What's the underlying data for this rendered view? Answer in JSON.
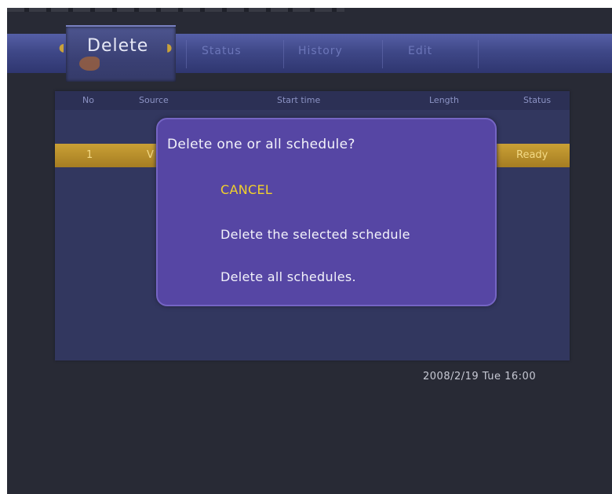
{
  "tabs": {
    "active": "Delete",
    "items": [
      "Status",
      "History",
      "Edit"
    ]
  },
  "table": {
    "headers": [
      "No",
      "Source",
      "Start time",
      "Length",
      "Status"
    ],
    "selected_row": {
      "no": "1",
      "source": "V",
      "status": "Ready"
    }
  },
  "dialog": {
    "title": "Delete one or all schedule?",
    "options": [
      "CANCEL",
      "Delete the selected schedule",
      "Delete all schedules."
    ],
    "selected_index": 0
  },
  "datetime": "2008/2/19 Tue 16:00",
  "colors": {
    "background": "#282a35",
    "tabbar": "#3f4888",
    "dialog": "#5646a4",
    "highlight": "#f2d12a",
    "selected_row": "#b88e2b"
  }
}
